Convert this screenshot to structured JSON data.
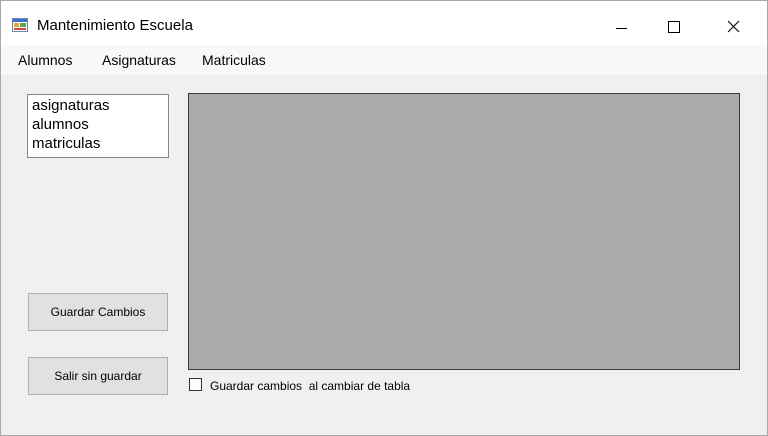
{
  "window": {
    "title": "Mantenimiento Escuela",
    "icon": "windows-form-app-icon",
    "controls": {
      "minimize_icon": "minimize-icon",
      "maximize_icon": "maximize-icon",
      "close_icon": "close-icon"
    }
  },
  "menu": {
    "items": [
      {
        "label": "Alumnos"
      },
      {
        "label": "Asignaturas"
      },
      {
        "label": "Matriculas"
      }
    ]
  },
  "table_list": {
    "items": [
      "asignaturas",
      "alumnos",
      "matriculas"
    ]
  },
  "buttons": {
    "save_label": "Guardar Cambios",
    "exit_label": "Salir sin guardar"
  },
  "option": {
    "save_on_switch_label": "Guardar cambios  al cambiar de tabla",
    "save_on_switch_checked": false
  },
  "colors": {
    "window_bg": "#f0f0f0",
    "grid_bg": "#ababab",
    "button_bg": "#e1e1e1"
  }
}
